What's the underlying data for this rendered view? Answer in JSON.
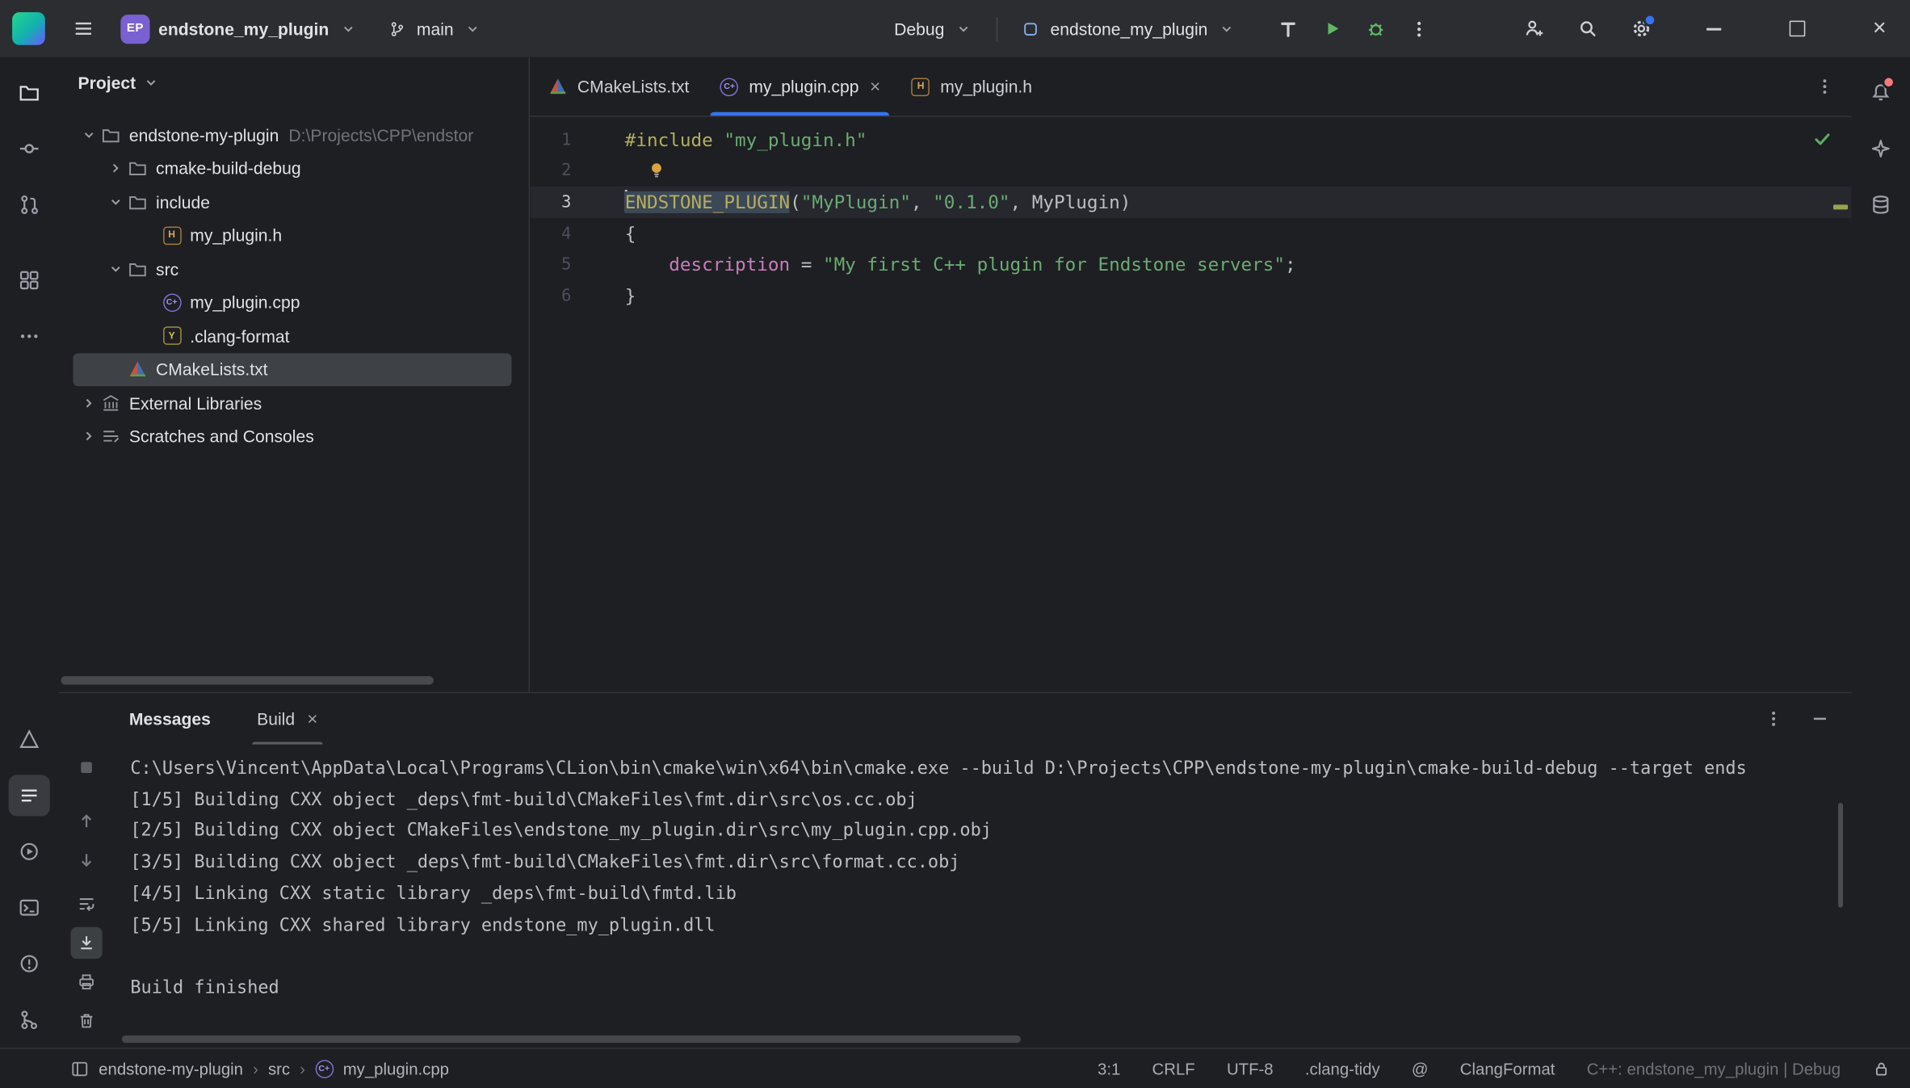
{
  "titlebar": {
    "project_badge": "EP",
    "project_name": "endstone_my_plugin",
    "branch_name": "main",
    "run_profile": "Debug",
    "run_target": "endstone_my_plugin"
  },
  "project_panel": {
    "title": "Project",
    "items": [
      {
        "label": "endstone-my-plugin",
        "path": "D:\\Projects\\CPP\\endstor",
        "icon": "folder-icon",
        "level": 0,
        "chevron": "down"
      },
      {
        "label": "cmake-build-debug",
        "icon": "folder-icon",
        "level": 1,
        "chevron": "right"
      },
      {
        "label": "include",
        "icon": "folder-icon",
        "level": 1,
        "chevron": "down"
      },
      {
        "label": "my_plugin.h",
        "icon": "h-file-icon",
        "level": 2,
        "chevron": null
      },
      {
        "label": "src",
        "icon": "folder-icon",
        "level": 1,
        "chevron": "down"
      },
      {
        "label": "my_plugin.cpp",
        "icon": "cpp-file-icon",
        "level": 2,
        "chevron": null
      },
      {
        "label": ".clang-format",
        "icon": "yaml-file-icon",
        "level": 2,
        "chevron": null
      },
      {
        "label": "CMakeLists.txt",
        "icon": "cmake-file-icon",
        "level": 1,
        "chevron": null,
        "selected": true
      },
      {
        "label": "External Libraries",
        "icon": "library-icon",
        "level": 0,
        "chevron": "right"
      },
      {
        "label": "Scratches and Consoles",
        "icon": "scratches-icon",
        "level": 0,
        "chevron": "right"
      }
    ]
  },
  "editor": {
    "tabs": [
      {
        "label": "CMakeLists.txt",
        "icon": "cmake-file-icon",
        "active": false,
        "closable": false
      },
      {
        "label": "my_plugin.cpp",
        "icon": "cpp-file-icon",
        "active": true,
        "closable": true
      },
      {
        "label": "my_plugin.h",
        "icon": "h-file-icon",
        "active": false,
        "closable": false
      }
    ],
    "code": [
      {
        "n": "1",
        "seg": [
          [
            "dir",
            "#include"
          ],
          [
            "pln",
            " "
          ],
          [
            "str",
            "\"my_plugin.h\""
          ]
        ]
      },
      {
        "n": "2",
        "bulb": true,
        "seg": []
      },
      {
        "n": "3",
        "current": true,
        "caret": true,
        "seg": [
          [
            "macro",
            "ENDSTONE_PLUGIN"
          ],
          [
            "pln",
            "("
          ],
          [
            "str",
            "\"MyPlugin\""
          ],
          [
            "pln",
            ", "
          ],
          [
            "str",
            "\"0.1.0\""
          ],
          [
            "pln",
            ", MyPlugin)"
          ]
        ]
      },
      {
        "n": "4",
        "seg": [
          [
            "pln",
            "{"
          ]
        ]
      },
      {
        "n": "5",
        "seg": [
          [
            "pln",
            "    "
          ],
          [
            "fld",
            "description"
          ],
          [
            "pln",
            " = "
          ],
          [
            "str",
            "\"My first C++ plugin for Endstone servers\""
          ],
          [
            "pln",
            ";"
          ]
        ]
      },
      {
        "n": "6",
        "seg": [
          [
            "pln",
            "}"
          ]
        ]
      }
    ]
  },
  "build_panel": {
    "title": "Messages",
    "tab_label": "Build",
    "lines": [
      "C:\\Users\\Vincent\\AppData\\Local\\Programs\\CLion\\bin\\cmake\\win\\x64\\bin\\cmake.exe --build D:\\Projects\\CPP\\endstone-my-plugin\\cmake-build-debug --target ends",
      "[1/5] Building CXX object _deps\\fmt-build\\CMakeFiles\\fmt.dir\\src\\os.cc.obj",
      "[2/5] Building CXX object CMakeFiles\\endstone_my_plugin.dir\\src\\my_plugin.cpp.obj",
      "[3/5] Building CXX object _deps\\fmt-build\\CMakeFiles\\fmt.dir\\src\\format.cc.obj",
      "[4/5] Linking CXX static library _deps\\fmt-build\\fmtd.lib",
      "[5/5] Linking CXX shared library endstone_my_plugin.dll",
      "",
      "Build finished"
    ]
  },
  "statusbar": {
    "breadcrumbs": [
      "endstone-my-plugin",
      "src",
      "my_plugin.cpp"
    ],
    "caret_position": "3:1",
    "line_separator": "CRLF",
    "encoding": "UTF-8",
    "clang_tidy": ".clang-tidy",
    "at_symbol": "@",
    "format": "ClangFormat",
    "run_context": "C++: endstone_my_plugin | Debug"
  }
}
